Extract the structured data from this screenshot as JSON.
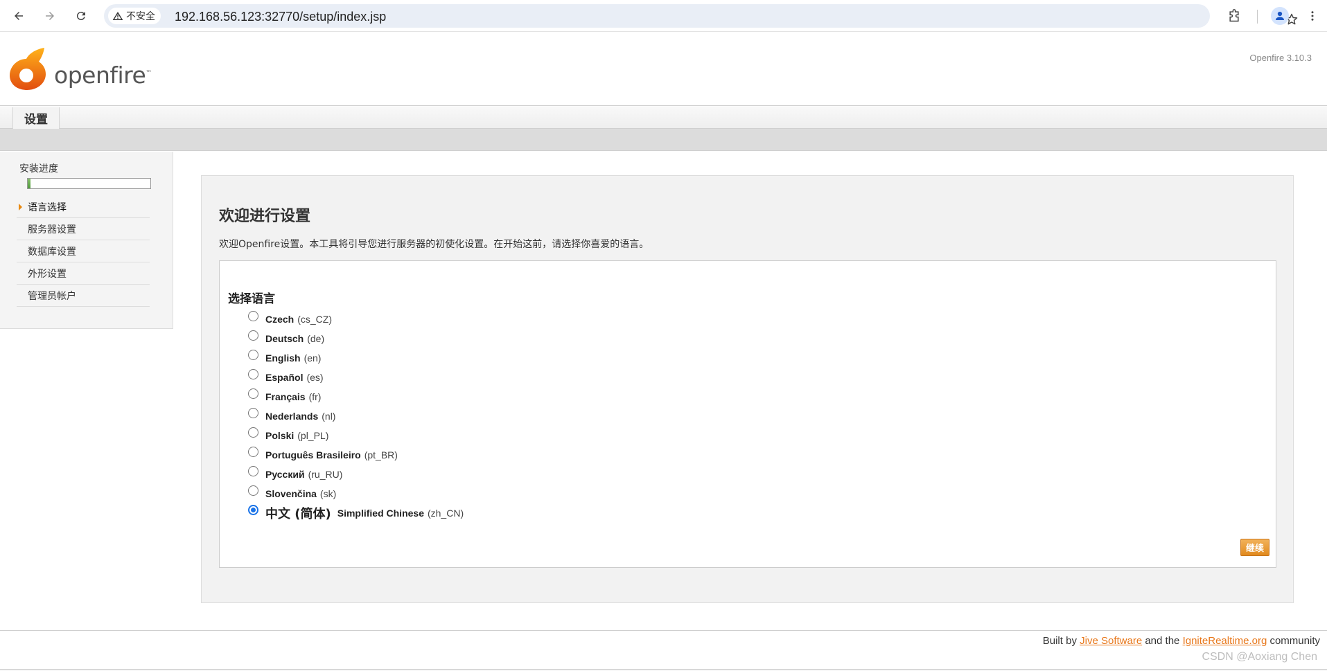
{
  "browser": {
    "security_label": "不安全",
    "url": "192.168.56.123:32770/setup/index.jsp",
    "icons": [
      "back-icon",
      "forward-icon",
      "reload-icon",
      "warning-icon",
      "star-icon",
      "extensions-icon",
      "profile-icon",
      "menu-icon"
    ]
  },
  "header": {
    "logo_text": "openfire",
    "logo_tm": "™",
    "version": "Openfire 3.10.3"
  },
  "tabs": [
    {
      "label": "设置"
    }
  ],
  "sidebar": {
    "progress_title": "安装进度",
    "progress_fraction": 0.02,
    "items": [
      {
        "label": "语言选择",
        "active": true
      },
      {
        "label": "服务器设置",
        "active": false
      },
      {
        "label": "数据库设置",
        "active": false
      },
      {
        "label": "外形设置",
        "active": false
      },
      {
        "label": "管理员帐户",
        "active": false
      }
    ]
  },
  "main": {
    "title": "欢迎进行设置",
    "intro": "欢迎Openfire设置。本工具将引导您进行服务器的初使化设置。在开始这前，请选择你喜爱的语言。",
    "section_title": "选择语言",
    "languages": [
      {
        "name": "Czech",
        "code": "(cs_CZ)",
        "checked": false
      },
      {
        "name": "Deutsch",
        "code": "(de)",
        "checked": false
      },
      {
        "name": "English",
        "code": "(en)",
        "checked": false
      },
      {
        "name": "Español",
        "code": "(es)",
        "checked": false
      },
      {
        "name": "Français",
        "code": "(fr)",
        "checked": false
      },
      {
        "name": "Nederlands",
        "code": "(nl)",
        "checked": false
      },
      {
        "name": "Polski",
        "code": "(pl_PL)",
        "checked": false
      },
      {
        "name": "Português Brasileiro",
        "code": "(pt_BR)",
        "checked": false
      },
      {
        "name": "Русский",
        "code": "(ru_RU)",
        "checked": false
      },
      {
        "name": "Slovenčina",
        "code": "(sk)",
        "checked": false
      },
      {
        "native": "中文 (简体)",
        "name": "Simplified Chinese",
        "code": "(zh_CN)",
        "checked": true
      }
    ],
    "continue_label": "继续"
  },
  "footer": {
    "built_by": "Built by",
    "jive_link": "Jive Software",
    "and_the": "and the",
    "ignite_link": "IgniteRealtime.org",
    "community": "community",
    "watermark": "CSDN @Aoxiang Chen"
  },
  "colors": {
    "accent_orange": "#e8771a",
    "radio_blue": "#1a73e8",
    "progress_green": "#4f9a3a"
  }
}
